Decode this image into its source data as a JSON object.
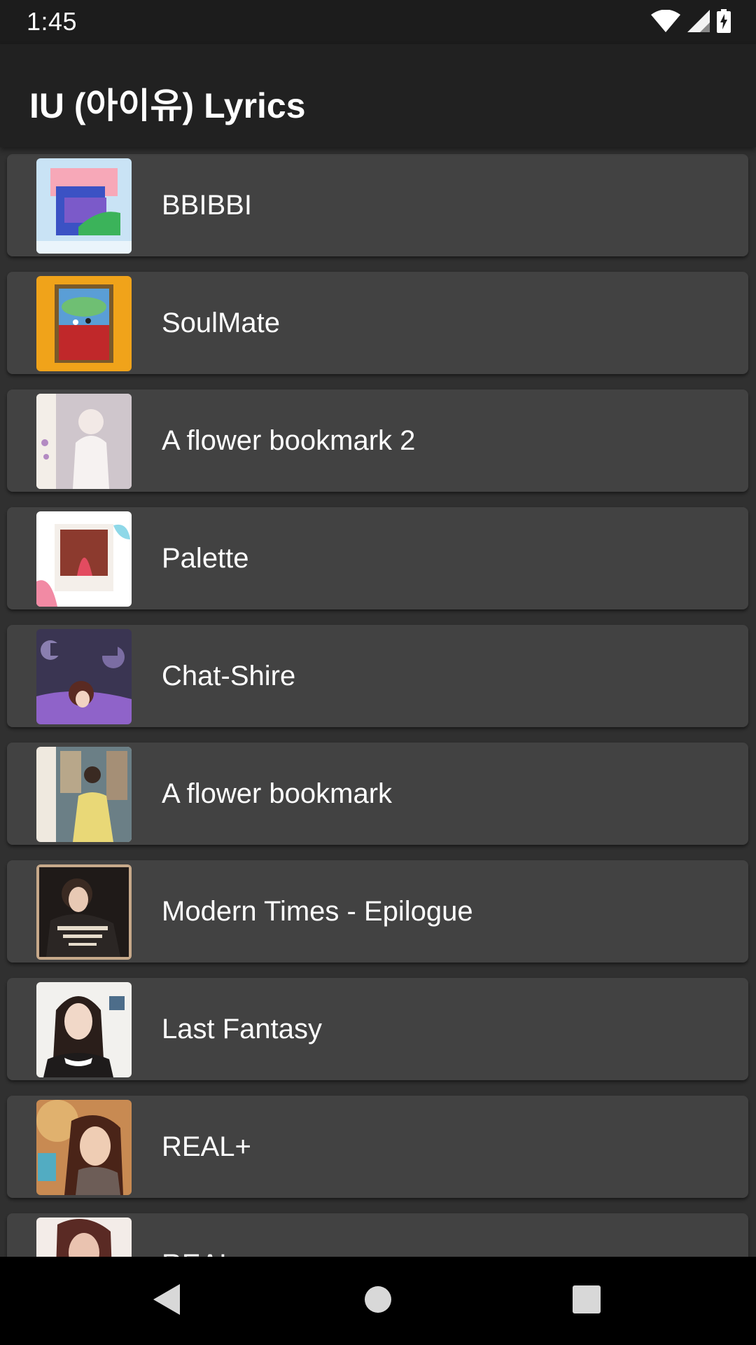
{
  "status_bar": {
    "time": "1:45",
    "icons": [
      "wifi-icon",
      "cell-signal-icon",
      "battery-charging-icon"
    ]
  },
  "app_bar": {
    "title": "IU (아이유) Lyrics"
  },
  "albums": [
    {
      "title": "BBIBBI",
      "art": "bbibbi-album-art"
    },
    {
      "title": "SoulMate",
      "art": "soulmate-album-art"
    },
    {
      "title": "A flower bookmark 2",
      "art": "flower-bookmark-2-album-art"
    },
    {
      "title": "Palette",
      "art": "palette-album-art"
    },
    {
      "title": "Chat-Shire",
      "art": "chat-shire-album-art"
    },
    {
      "title": "A flower bookmark",
      "art": "flower-bookmark-album-art"
    },
    {
      "title": "Modern Times - Epilogue",
      "art": "modern-times-epilogue-album-art"
    },
    {
      "title": "Last Fantasy",
      "art": "last-fantasy-album-art"
    },
    {
      "title": "REAL+",
      "art": "real-plus-album-art"
    },
    {
      "title": "REAL",
      "art": "real-album-art"
    }
  ],
  "nav_bar": {
    "icons": [
      "back-icon",
      "home-icon",
      "recents-icon"
    ]
  },
  "colors": {
    "status_bar_bg": "#1c1c1c",
    "app_bar_bg": "#212121",
    "list_bg": "#303030",
    "card_bg": "#424242",
    "nav_bar_bg": "#000000",
    "text": "#ffffff"
  }
}
